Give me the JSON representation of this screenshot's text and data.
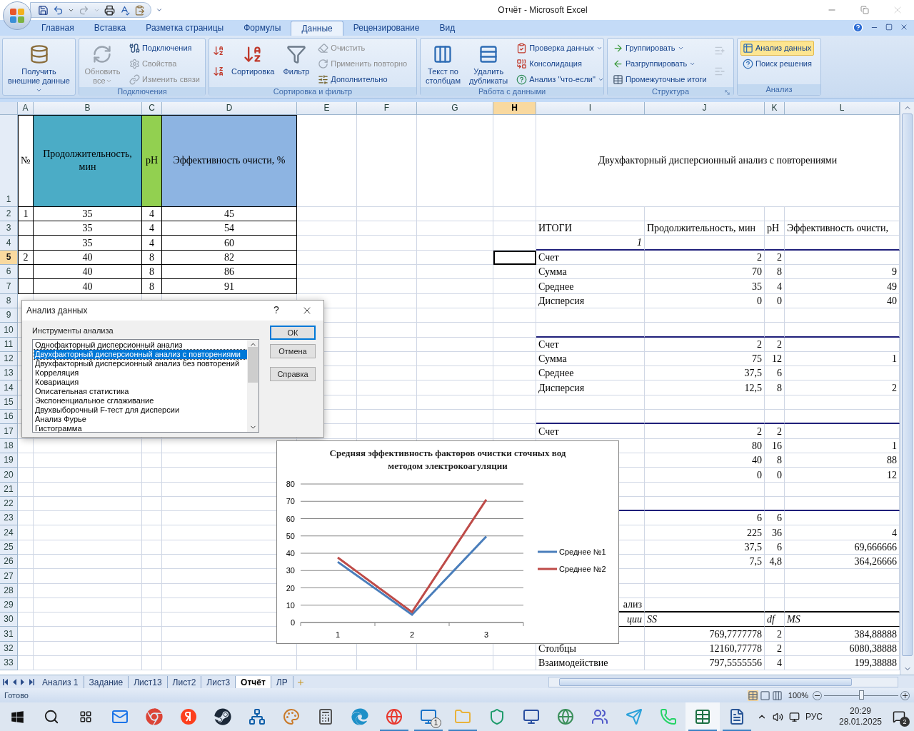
{
  "window": {
    "title": "Отчёт - Microsoft Excel"
  },
  "ribbon": {
    "tabs": [
      {
        "label": "Главная",
        "selected": false
      },
      {
        "label": "Вставка",
        "selected": false
      },
      {
        "label": "Разметка страницы",
        "selected": false
      },
      {
        "label": "Формулы",
        "selected": false
      },
      {
        "label": "Данные",
        "selected": true
      },
      {
        "label": "Рецензирование",
        "selected": false
      },
      {
        "label": "Вид",
        "selected": false
      }
    ],
    "groups": [
      {
        "launcher": false,
        "items": [
          {
            "kind": "large",
            "label": "Получить внешние данные",
            "dropdown": true,
            "disabled": false,
            "highlighted": false
          }
        ]
      },
      {
        "label": "Подключения",
        "launcher": false,
        "items": [
          {
            "kind": "large",
            "label": "Обновить все",
            "dropdown": true,
            "disabled": true,
            "highlighted": false
          },
          {
            "kind": "small",
            "label": "Подключения",
            "dropdown": false,
            "disabled": false,
            "highlighted": false
          },
          {
            "kind": "small",
            "label": "Свойства",
            "dropdown": false,
            "disabled": true,
            "highlighted": false
          },
          {
            "kind": "small",
            "label": "Изменить связи",
            "dropdown": false,
            "disabled": true,
            "highlighted": false
          }
        ]
      },
      {
        "label": "Сортировка и фильтр",
        "launcher": false,
        "items": [
          {
            "kind": "icon",
            "dropdown": false,
            "disabled": false,
            "highlighted": false
          },
          {
            "kind": "icon",
            "dropdown": false,
            "disabled": false,
            "highlighted": false
          },
          {
            "kind": "large",
            "label": "Сортировка",
            "dropdown": false,
            "disabled": false,
            "highlighted": false
          },
          {
            "kind": "large",
            "label": "Фильтр",
            "dropdown": false,
            "disabled": false,
            "highlighted": false
          },
          {
            "kind": "small",
            "label": "Очистить",
            "dropdown": false,
            "disabled": true,
            "highlighted": false
          },
          {
            "kind": "small",
            "label": "Применить повторно",
            "dropdown": false,
            "disabled": true,
            "highlighted": false
          },
          {
            "kind": "small",
            "label": "Дополнительно",
            "dropdown": false,
            "disabled": false,
            "highlighted": false
          }
        ]
      },
      {
        "label": "Работа с данными",
        "launcher": false,
        "items": [
          {
            "kind": "large",
            "label": "Текст по столбцам",
            "dropdown": false,
            "disabled": false,
            "highlighted": false
          },
          {
            "kind": "large",
            "label": "Удалить дубликаты",
            "dropdown": false,
            "disabled": false,
            "highlighted": false
          },
          {
            "kind": "small",
            "label": "Проверка данных",
            "dropdown": true,
            "disabled": false,
            "highlighted": false
          },
          {
            "kind": "small",
            "label": "Консолидация",
            "dropdown": false,
            "disabled": false,
            "highlighted": false
          },
          {
            "kind": "small",
            "label": "Анализ \"что-если\"",
            "dropdown": true,
            "disabled": false,
            "highlighted": false
          }
        ]
      },
      {
        "label": "Структура",
        "launcher": true,
        "items": [
          {
            "kind": "small",
            "label": "Группировать",
            "dropdown": true,
            "disabled": false,
            "highlighted": false
          },
          {
            "kind": "small",
            "label": "Разгруппировать",
            "dropdown": true,
            "disabled": false,
            "highlighted": false
          },
          {
            "kind": "small",
            "label": "Промежуточные итоги",
            "dropdown": false,
            "disabled": false,
            "highlighted": false
          },
          {
            "kind": "icon",
            "dropdown": false,
            "disabled": true,
            "highlighted": false
          },
          {
            "kind": "icon",
            "dropdown": false,
            "disabled": true,
            "highlighted": false
          }
        ]
      },
      {
        "label": "Анализ",
        "launcher": false,
        "items": [
          {
            "kind": "small",
            "label": "Анализ данных",
            "dropdown": false,
            "disabled": false,
            "highlighted": true
          },
          {
            "kind": "small",
            "label": "Поиск решения",
            "dropdown": false,
            "disabled": false,
            "highlighted": false
          }
        ]
      }
    ]
  },
  "sheet": {
    "columns": [
      {
        "label": "A",
        "selected": false
      },
      {
        "label": "B",
        "selected": false
      },
      {
        "label": "C",
        "selected": false
      },
      {
        "label": "D",
        "selected": false
      },
      {
        "label": "E",
        "selected": false
      },
      {
        "label": "F",
        "selected": false
      },
      {
        "label": "G",
        "selected": false
      },
      {
        "label": "H",
        "selected": true
      },
      {
        "label": "I",
        "selected": false
      },
      {
        "label": "J",
        "selected": false
      },
      {
        "label": "K",
        "selected": false
      },
      {
        "label": "L",
        "selected": false
      }
    ],
    "rows": [
      {
        "number": "1",
        "selected": false,
        "frame": true,
        "cells": {
          "c1": {
            "text": "№",
            "kind": "center"
          },
          "c2": {
            "text": "Продолжительность, мин",
            "kind": "center",
            "color": "#4bacc6"
          },
          "c3": {
            "text": "pH",
            "kind": "center",
            "color": "#92d050"
          },
          "c4": {
            "text": "Эффективность очисти, %",
            "kind": "center",
            "color": "#8db4e2"
          },
          "c9": {
            "text": "Двухфакторный дисперсионный анализ с повторениями",
            "kind": "title"
          }
        }
      },
      {
        "number": "2",
        "selected": false,
        "frame": true,
        "cells": {
          "c1": {
            "text": "1",
            "kind": "center"
          },
          "c2": {
            "text": "35",
            "kind": "center"
          },
          "c3": {
            "text": "4",
            "kind": "center"
          },
          "c4": {
            "text": "45",
            "kind": "center"
          }
        }
      },
      {
        "number": "3",
        "selected": false,
        "frame": true,
        "cells": {
          "c2": {
            "text": "35",
            "kind": "center"
          },
          "c3": {
            "text": "4",
            "kind": "center"
          },
          "c4": {
            "text": "54",
            "kind": "center"
          },
          "c9": {
            "text": "ИТОГИ",
            "kind": "text"
          },
          "c10": {
            "text": "Продолжительность, мин",
            "kind": "text"
          },
          "c11": {
            "text": "pH",
            "kind": "text"
          },
          "c12": {
            "text": "Эффективность очисти,",
            "kind": "text"
          }
        }
      },
      {
        "number": "4",
        "selected": false,
        "frame": true,
        "kind": "group-end",
        "cells": {
          "c2": {
            "text": "35",
            "kind": "center"
          },
          "c3": {
            "text": "4",
            "kind": "center"
          },
          "c4": {
            "text": "60",
            "kind": "center"
          },
          "c9": {
            "text": "1",
            "kind": "italic-right"
          }
        }
      },
      {
        "number": "5",
        "selected": true,
        "frame": true,
        "cells": {
          "c1": {
            "text": "2",
            "kind": "center"
          },
          "c2": {
            "text": "40",
            "kind": "center"
          },
          "c3": {
            "text": "8",
            "kind": "center"
          },
          "c4": {
            "text": "82",
            "kind": "center"
          },
          "c9": {
            "text": "Счет",
            "kind": "text"
          },
          "c10": {
            "text": "2",
            "kind": "num"
          },
          "c11": {
            "text": "2",
            "kind": "num"
          }
        }
      },
      {
        "number": "6",
        "selected": false,
        "frame": true,
        "cells": {
          "c2": {
            "text": "40",
            "kind": "center"
          },
          "c3": {
            "text": "8",
            "kind": "center"
          },
          "c4": {
            "text": "86",
            "kind": "center"
          },
          "c9": {
            "text": "Сумма",
            "kind": "text"
          },
          "c10": {
            "text": "70",
            "kind": "num"
          },
          "c11": {
            "text": "8",
            "kind": "num"
          },
          "c12": {
            "text": "9",
            "kind": "num"
          }
        }
      },
      {
        "number": "7",
        "selected": false,
        "frame": true,
        "cells": {
          "c2": {
            "text": "40",
            "kind": "center"
          },
          "c3": {
            "text": "8",
            "kind": "center"
          },
          "c4": {
            "text": "91",
            "kind": "center"
          },
          "c9": {
            "text": "Среднее",
            "kind": "text"
          },
          "c10": {
            "text": "35",
            "kind": "num"
          },
          "c11": {
            "text": "4",
            "kind": "num"
          },
          "c12": {
            "text": "49",
            "kind": "num"
          }
        }
      },
      {
        "number": "8",
        "selected": false,
        "frame": false,
        "cells": {
          "c9": {
            "text": "Дисперсия",
            "kind": "text"
          },
          "c10": {
            "text": "0",
            "kind": "num"
          },
          "c11": {
            "text": "0",
            "kind": "num"
          },
          "c12": {
            "text": "40",
            "kind": "num"
          }
        }
      },
      {
        "number": "9",
        "selected": false,
        "frame": false,
        "cells": {}
      },
      {
        "number": "10",
        "selected": false,
        "frame": false,
        "kind": "group-end",
        "cells": {}
      },
      {
        "number": "11",
        "selected": false,
        "frame": false,
        "cells": {
          "c9": {
            "text": "Счет",
            "kind": "text"
          },
          "c10": {
            "text": "2",
            "kind": "num"
          },
          "c11": {
            "text": "2",
            "kind": "num"
          }
        }
      },
      {
        "number": "12",
        "selected": false,
        "frame": false,
        "cells": {
          "c9": {
            "text": "Сумма",
            "kind": "text"
          },
          "c10": {
            "text": "75",
            "kind": "num"
          },
          "c11": {
            "text": "12",
            "kind": "num"
          },
          "c12": {
            "text": "1",
            "kind": "num"
          }
        }
      },
      {
        "number": "13",
        "selected": false,
        "frame": false,
        "cells": {
          "c9": {
            "text": "Среднее",
            "kind": "text"
          },
          "c10": {
            "text": "37,5",
            "kind": "num"
          },
          "c11": {
            "text": "6",
            "kind": "num"
          }
        }
      },
      {
        "number": "14",
        "selected": false,
        "frame": false,
        "cells": {
          "c9": {
            "text": "Дисперсия",
            "kind": "text"
          },
          "c10": {
            "text": "12,5",
            "kind": "num"
          },
          "c11": {
            "text": "8",
            "kind": "num"
          },
          "c12": {
            "text": "2",
            "kind": "num"
          }
        }
      },
      {
        "number": "15",
        "selected": false,
        "frame": false,
        "cells": {}
      },
      {
        "number": "16",
        "selected": false,
        "frame": false,
        "kind": "group-end",
        "cells": {}
      },
      {
        "number": "17",
        "selected": false,
        "frame": false,
        "cells": {
          "c9": {
            "text": "Счет",
            "kind": "text"
          },
          "c10": {
            "text": "2",
            "kind": "num"
          },
          "c11": {
            "text": "2",
            "kind": "num"
          }
        }
      },
      {
        "number": "18",
        "selected": false,
        "frame": false,
        "cells": {
          "c10": {
            "text": "80",
            "kind": "num"
          },
          "c11": {
            "text": "16",
            "kind": "num"
          },
          "c12": {
            "text": "1",
            "kind": "num"
          }
        }
      },
      {
        "number": "19",
        "selected": false,
        "frame": false,
        "cells": {
          "c10": {
            "text": "40",
            "kind": "num"
          },
          "c11": {
            "text": "8",
            "kind": "num"
          },
          "c12": {
            "text": "88",
            "kind": "num"
          }
        }
      },
      {
        "number": "20",
        "selected": false,
        "frame": false,
        "cells": {
          "c10": {
            "text": "0",
            "kind": "num"
          },
          "c11": {
            "text": "0",
            "kind": "num"
          },
          "c12": {
            "text": "12",
            "kind": "num"
          }
        }
      },
      {
        "number": "21",
        "selected": false,
        "frame": false,
        "cells": {}
      },
      {
        "number": "22",
        "selected": false,
        "frame": false,
        "kind": "group-end",
        "cells": {}
      },
      {
        "number": "23",
        "selected": false,
        "frame": false,
        "cells": {
          "c10": {
            "text": "6",
            "kind": "num"
          },
          "c11": {
            "text": "6",
            "kind": "num"
          }
        }
      },
      {
        "number": "24",
        "selected": false,
        "frame": false,
        "cells": {
          "c10": {
            "text": "225",
            "kind": "num"
          },
          "c11": {
            "text": "36",
            "kind": "num"
          },
          "c12": {
            "text": "4",
            "kind": "num"
          }
        }
      },
      {
        "number": "25",
        "selected": false,
        "frame": false,
        "cells": {
          "c10": {
            "text": "37,5",
            "kind": "num"
          },
          "c11": {
            "text": "6",
            "kind": "num"
          },
          "c12": {
            "text": "69,666666",
            "kind": "num"
          }
        }
      },
      {
        "number": "26",
        "selected": false,
        "frame": false,
        "cells": {
          "c10": {
            "text": "7,5",
            "kind": "num"
          },
          "c11": {
            "text": "4,8",
            "kind": "num"
          },
          "c12": {
            "text": "364,26666",
            "kind": "num"
          }
        }
      },
      {
        "number": "27",
        "selected": false,
        "frame": false,
        "cells": {}
      },
      {
        "number": "28",
        "selected": false,
        "frame": false,
        "cells": {}
      },
      {
        "number": "29",
        "selected": false,
        "frame": false,
        "kind": "table-top",
        "cells": {
          "c9": {
            "text": "ализ",
            "kind": "right"
          }
        }
      },
      {
        "number": "30",
        "selected": false,
        "frame": false,
        "kind": "table-head",
        "cells": {
          "c9": {
            "text": "ции",
            "kind": "italic-right"
          },
          "c10": {
            "text": "SS",
            "kind": "italic"
          },
          "c11": {
            "text": "df",
            "kind": "italic"
          },
          "c12": {
            "text": "MS",
            "kind": "italic"
          }
        }
      },
      {
        "number": "31",
        "selected": false,
        "frame": false,
        "cells": {
          "c10": {
            "text": "769,7777778",
            "kind": "num"
          },
          "c11": {
            "text": "2",
            "kind": "num"
          },
          "c12": {
            "text": "384,88888",
            "kind": "num"
          }
        }
      },
      {
        "number": "32",
        "selected": false,
        "frame": false,
        "cells": {
          "c9": {
            "text": "Столбцы",
            "kind": "text"
          },
          "c10": {
            "text": "12160,77778",
            "kind": "num"
          },
          "c11": {
            "text": "2",
            "kind": "num"
          },
          "c12": {
            "text": "6080,38888",
            "kind": "num"
          }
        }
      },
      {
        "number": "33",
        "selected": false,
        "frame": false,
        "cells": {
          "c9": {
            "text": "Взаимодействие",
            "kind": "text"
          },
          "c10": {
            "text": "797,5555556",
            "kind": "num"
          },
          "c11": {
            "text": "4",
            "kind": "num"
          },
          "c12": {
            "text": "199,38888",
            "kind": "num"
          }
        }
      }
    ]
  },
  "chart": {
    "chart_data": {
      "type": "line",
      "grid": true,
      "legend": "right",
      "title": "Средняя эффективность факторов очистки сточных вод методом электрокоагуляции",
      "categories": [
        "1",
        "2",
        "3"
      ],
      "ylim": [
        0,
        80
      ],
      "yticks": [
        {
          "value": 0,
          "label": "0"
        },
        {
          "value": 10,
          "label": "10"
        },
        {
          "value": 20,
          "label": "20"
        },
        {
          "value": 30,
          "label": "30"
        },
        {
          "value": 40,
          "label": "40"
        },
        {
          "value": 50,
          "label": "50"
        },
        {
          "value": 60,
          "label": "60"
        },
        {
          "value": 70,
          "label": "70"
        },
        {
          "value": 80,
          "label": "80"
        }
      ],
      "series": [
        {
          "name": "Среднее №1",
          "color": "#4a7ebb",
          "values": [
            35,
            4.5,
            49.7
          ]
        },
        {
          "name": "Среднее №2",
          "color": "#be4b48",
          "values": [
            37.5,
            6,
            71
          ]
        }
      ]
    }
  },
  "dialog": {
    "title": "Анализ данных",
    "help": "?",
    "list_label": "Инструменты анализа",
    "tools": [
      {
        "label": "Однофакторный дисперсионный анализ",
        "selected": false
      },
      {
        "label": "Двухфакторный дисперсионный анализ с повторениями",
        "selected": true
      },
      {
        "label": "Двухфакторный дисперсионный анализ без повторений",
        "selected": false
      },
      {
        "label": "Корреляция",
        "selected": false
      },
      {
        "label": "Ковариация",
        "selected": false
      },
      {
        "label": "Описательная статистика",
        "selected": false
      },
      {
        "label": "Экспоненциальное сглаживание",
        "selected": false
      },
      {
        "label": "Двухвыборочный F-тест для дисперсии",
        "selected": false
      },
      {
        "label": "Анализ Фурье",
        "selected": false
      },
      {
        "label": "Гистограмма",
        "selected": false
      }
    ],
    "buttons": [
      {
        "label": "ОК",
        "default": true
      },
      {
        "label": "Отмена",
        "default": false
      },
      {
        "label": "Справка",
        "default": false
      }
    ]
  },
  "sheet_tabs": [
    {
      "label": "Анализ 1",
      "selected": false
    },
    {
      "label": "Задание",
      "selected": false
    },
    {
      "label": "Лист13",
      "selected": false
    },
    {
      "label": "Лист2",
      "selected": false
    },
    {
      "label": "Лист3",
      "selected": false
    },
    {
      "label": "Отчёт",
      "selected": true
    },
    {
      "label": "ЛР",
      "selected": false
    }
  ],
  "status_bar": {
    "status": "Готово",
    "zoom": "100%",
    "zoom_slider": {
      "level": 0.5
    }
  },
  "taskbar": {
    "apps": [
      {
        "running": false,
        "selected": false
      },
      {
        "running": false,
        "selected": false
      },
      {
        "running": false,
        "selected": false
      },
      {
        "running": false,
        "selected": false
      },
      {
        "running": false,
        "selected": false
      },
      {
        "running": false,
        "selected": false
      },
      {
        "running": false,
        "selected": false
      },
      {
        "running": false,
        "selected": false
      },
      {
        "running": true,
        "selected": false
      },
      {
        "running": true,
        "selected": false,
        "badge": "1"
      },
      {
        "running": true,
        "selected": false
      },
      {
        "running": false,
        "selected": false
      },
      {
        "running": false,
        "selected": false
      },
      {
        "running": false,
        "selected": false
      },
      {
        "running": false,
        "selected": false
      },
      {
        "running": false,
        "selected": false
      },
      {
        "running": false,
        "selected": false
      },
      {
        "running": true,
        "selected": true
      },
      {
        "running": true,
        "selected": false
      }
    ],
    "language": "РУС",
    "time": "20:29",
    "date": "28.01.2025",
    "notifications": "2"
  }
}
